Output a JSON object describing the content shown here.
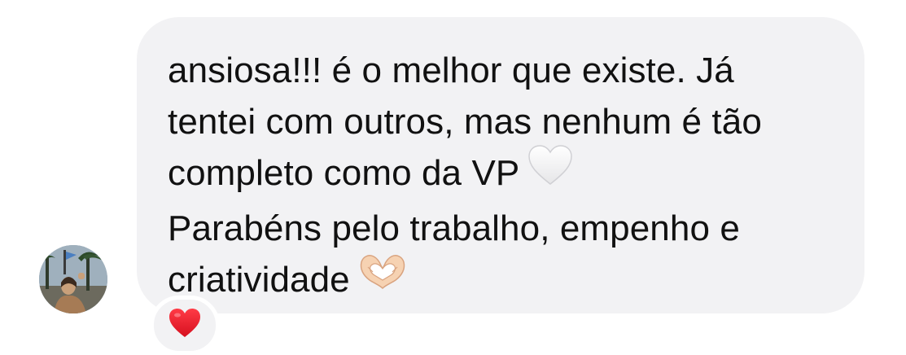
{
  "message": {
    "lines": [
      "ansiosa!!! é o melhor que existe. Já",
      "tentei com outros, mas nenhum é tão",
      "completo como da VP",
      "Parabéns pelo trabalho, empenho e",
      "criatividade"
    ],
    "line3_emoji": "white-heart-icon",
    "line5_emoji": "heart-hands-icon"
  },
  "reaction": {
    "icon": "red-heart-icon",
    "color": "#e8192c"
  },
  "colors": {
    "bubble": "#f2f2f4",
    "text": "#111111"
  }
}
